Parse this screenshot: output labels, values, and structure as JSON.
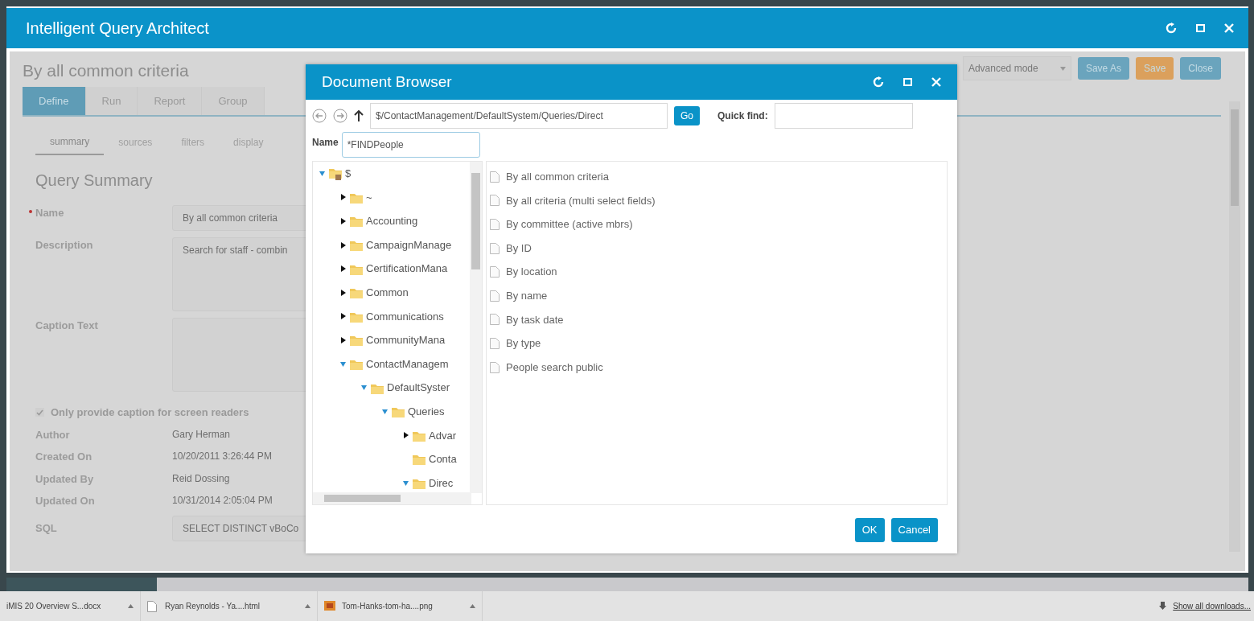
{
  "window": {
    "title": "Intelligent Query Architect"
  },
  "query": {
    "title": "By all common criteria",
    "mode": "Advanced mode",
    "actions": [
      {
        "label": "Save As",
        "kind": "info"
      },
      {
        "label": "Save",
        "kind": "warning"
      },
      {
        "label": "Close",
        "kind": "info"
      }
    ],
    "tabs": [
      {
        "label": "Define",
        "selected": true
      },
      {
        "label": "Run",
        "selected": false
      },
      {
        "label": "Report",
        "selected": false
      },
      {
        "label": "Group",
        "selected": false
      }
    ],
    "subtabs": [
      {
        "label": "summary",
        "selected": true
      },
      {
        "label": "sources",
        "selected": false
      },
      {
        "label": "filters",
        "selected": false
      },
      {
        "label": "display",
        "selected": false
      }
    ],
    "section_title": "Query Summary",
    "fields": [
      {
        "label": "Name",
        "required": true,
        "kind": "input",
        "value": "By all common criteria"
      },
      {
        "label": "Description",
        "required": false,
        "kind": "textarea",
        "value": "Search for staff - combin"
      },
      {
        "label": "Caption Text",
        "required": false,
        "kind": "textarea"
      }
    ],
    "caption_checkbox": {
      "label": "Only provide caption for screen readers",
      "checked": true
    },
    "info": [
      {
        "label": "Author",
        "value": "Gary Herman"
      },
      {
        "label": "Created On",
        "value": "10/20/2011 3:26:44 PM"
      },
      {
        "label": "Updated By",
        "value": "Reid Dossing"
      },
      {
        "label": "Updated On",
        "value": "10/31/2014 2:05:04 PM"
      }
    ],
    "sql": {
      "label": "SQL",
      "value": "SELECT DISTINCT vBoCo"
    }
  },
  "dialog": {
    "title": "Document Browser",
    "path": "$/ContactManagement/DefaultSystem/Queries/Direct",
    "go": "Go",
    "quick_find_label": "Quick find:",
    "name_label": "Name",
    "name_value": "*FINDPeople",
    "tree": [
      {
        "label": "$",
        "kind": "root",
        "expanded": true,
        "children": [
          {
            "label": "~",
            "kind": "folder",
            "expanded": false
          },
          {
            "label": "Accounting",
            "kind": "folder",
            "expanded": false
          },
          {
            "label": "CampaignManage",
            "kind": "folder",
            "expanded": false
          },
          {
            "label": "CertificationMana",
            "kind": "folder",
            "expanded": false
          },
          {
            "label": "Common",
            "kind": "folder",
            "expanded": false
          },
          {
            "label": "Communications",
            "kind": "folder",
            "expanded": false
          },
          {
            "label": "CommunityMana",
            "kind": "folder",
            "expanded": false
          },
          {
            "label": "ContactManagem",
            "kind": "folder",
            "expanded": true,
            "children": [
              {
                "label": "DefaultSyster",
                "kind": "folder",
                "expanded": true,
                "children": [
                  {
                    "label": "Queries",
                    "kind": "folder",
                    "expanded": true,
                    "children": [
                      {
                        "label": "Advar",
                        "kind": "folder",
                        "expanded": false
                      },
                      {
                        "label": "Conta",
                        "kind": "folder"
                      },
                      {
                        "label": "Direc",
                        "kind": "folder",
                        "expanded": true
                      }
                    ]
                  }
                ]
              }
            ]
          }
        ]
      }
    ],
    "files": [
      "By all common criteria",
      "By all criteria (multi select fields)",
      "By committee (active mbrs)",
      "By ID",
      "By location",
      "By name",
      "By task date",
      "By type",
      "People search public"
    ],
    "buttons": [
      "OK",
      "Cancel"
    ]
  },
  "downloads": {
    "items": [
      {
        "label": "iMIS 20 Overview S...docx",
        "kind": "doc"
      },
      {
        "label": "Ryan Reynolds - Ya....html",
        "kind": "page"
      },
      {
        "label": "Tom-Hanks-tom-ha....png",
        "kind": "image"
      }
    ],
    "show_all": "Show all downloads..."
  }
}
